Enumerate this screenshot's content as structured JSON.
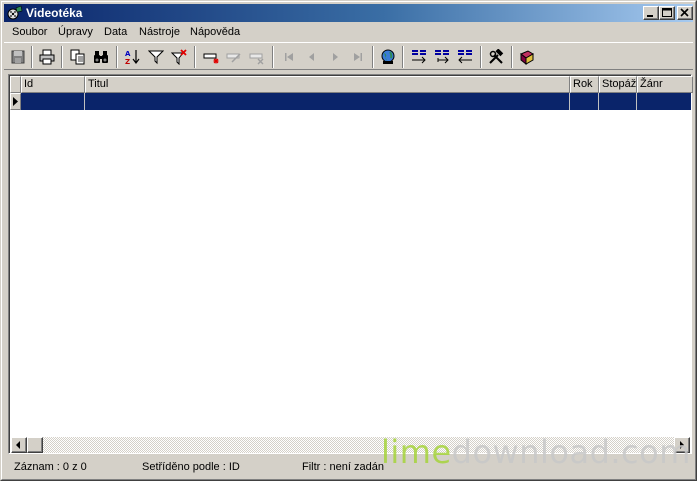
{
  "window": {
    "title": "Videotéka",
    "icon": "film-reel-icon"
  },
  "menu": [
    {
      "label": "Soubor"
    },
    {
      "label": "Úpravy"
    },
    {
      "label": "Data"
    },
    {
      "label": "Nástroje"
    },
    {
      "label": "Nápověda"
    }
  ],
  "grid": {
    "columns": [
      {
        "label": "Id"
      },
      {
        "label": "Titul"
      },
      {
        "label": "Rok"
      },
      {
        "label": "Stopáž"
      },
      {
        "label": "Žánr"
      }
    ],
    "rows": [
      {
        "id": "",
        "titul": "",
        "rok": "",
        "stopaz": "",
        "zanr": "",
        "selected": true
      }
    ]
  },
  "status": {
    "record": "Záznam : 0 z 0",
    "sorted": "Setříděno podle : ID",
    "filter": "Filtr : není zadán"
  },
  "watermark": {
    "part1": "lime",
    "part2": "download.com"
  },
  "colors": {
    "title_start": "#0a246a",
    "title_end": "#a6caf0",
    "selection": "#0a246a",
    "face": "#d4d0c8"
  }
}
